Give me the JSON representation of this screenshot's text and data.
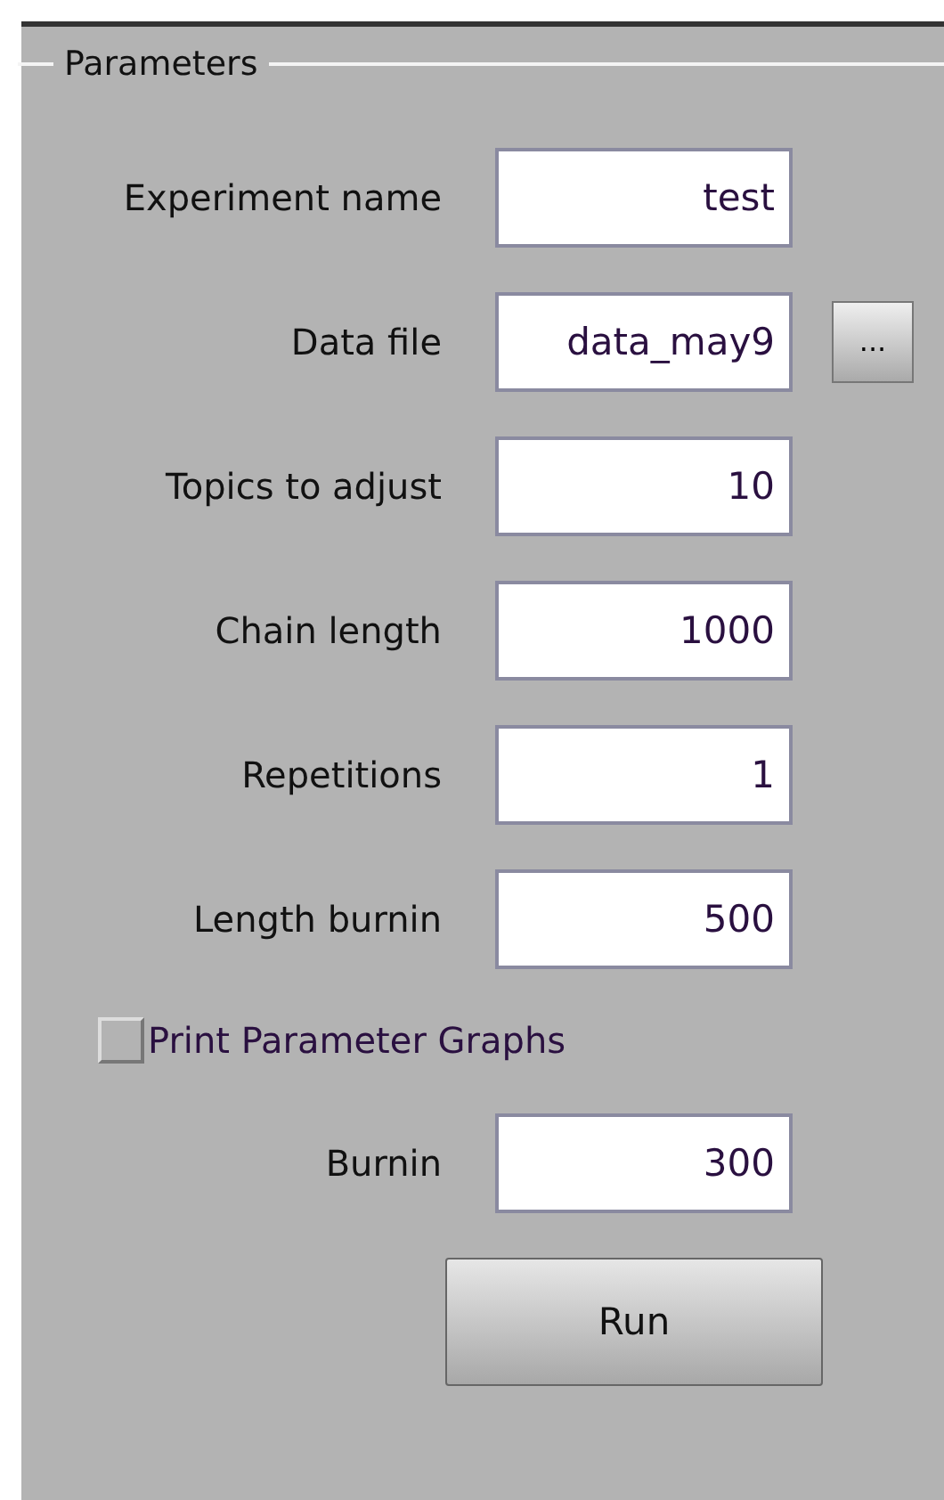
{
  "panel": {
    "title": "Parameters"
  },
  "rows": [
    {
      "kind": "field",
      "label": "Experiment name",
      "value": "test"
    },
    {
      "kind": "file",
      "label": "Data file",
      "value": "data_may9",
      "button": "..."
    },
    {
      "kind": "field",
      "label": "Topics to adjust",
      "value": "10"
    },
    {
      "kind": "field",
      "label": "Chain length",
      "value": "1000"
    },
    {
      "kind": "field",
      "label": "Repetitions",
      "value": "1"
    },
    {
      "kind": "field",
      "label": "Length burnin",
      "value": "500"
    },
    {
      "kind": "checkbox",
      "label": "Print Parameter Graphs",
      "checked": false
    },
    {
      "kind": "field",
      "label": "Burnin",
      "value": "300"
    },
    {
      "kind": "button",
      "label": "Run"
    }
  ]
}
